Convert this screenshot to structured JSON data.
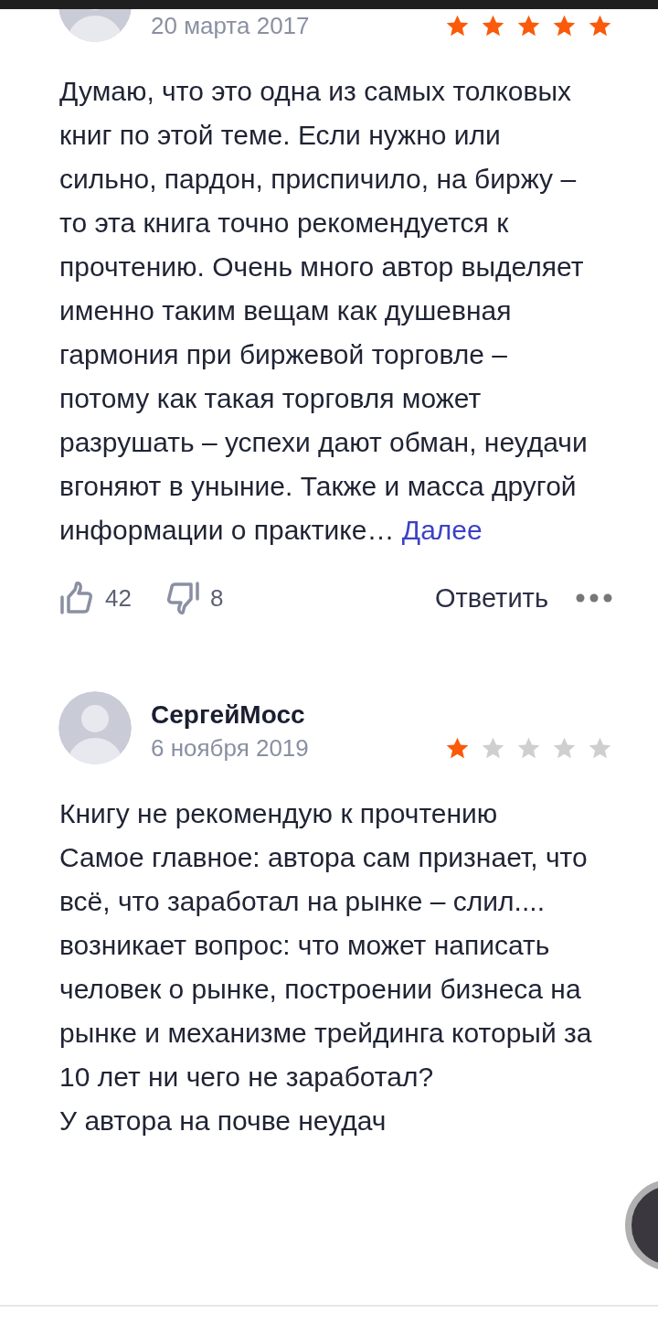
{
  "reviews": [
    {
      "date": "20 марта 2017",
      "stars": 5,
      "text": "Думаю, что это одна из самых толковых книг по этой теме. Если нужно или сильно, пардон, приспичило, на биржу – то эта книга точно рекомендуется к прочтению. Очень много автор выделяет именно таким вещам как душевная гармония при биржевой торговле – потому как такая торговля может разрушать – успехи дают обман, неудачи вгоняют в уныние. Также и масса другой информации о практике…",
      "more_link": "Далее",
      "likes": "42",
      "dislikes": "8",
      "reply_label": "Ответить"
    },
    {
      "author": "СергейМосс",
      "date": "6 ноября 2019",
      "stars": 1,
      "text": "Книгу не рекомендую к прочтению\nСамое главное: автора сам признает, что всё, что заработал на рынке – слил....\nвозникает вопрос: что может написать человек о рынке, построении бизнеса на рынке и механизме трейдинга который за 10 лет ни чего не заработал?\nУ автора на почве неудач"
    }
  ]
}
